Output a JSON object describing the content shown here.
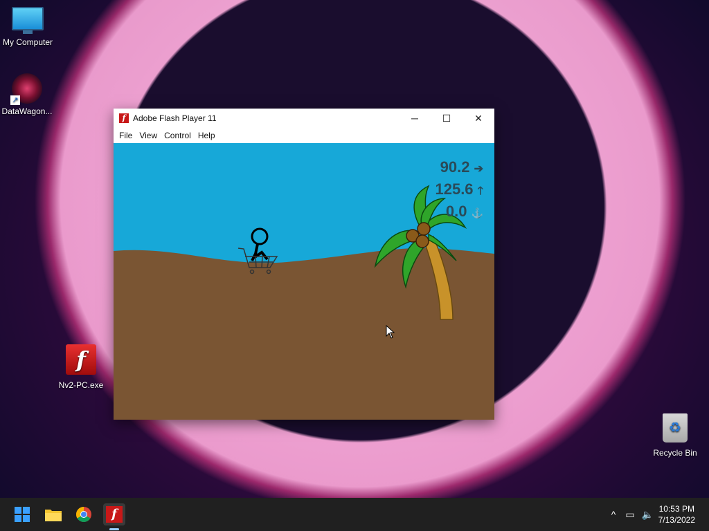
{
  "desktop": {
    "icons": [
      {
        "label": "My Computer",
        "icon": "computer-icon"
      },
      {
        "label": "DataWagon...",
        "icon": "datawagon-icon"
      },
      {
        "label": "Nv2-PC.exe",
        "icon": "flash-exe-icon"
      },
      {
        "label": "Recycle Bin",
        "icon": "recycle-bin-icon"
      }
    ]
  },
  "window": {
    "title": "Adobe Flash Player 11",
    "menu": [
      "File",
      "View",
      "Control",
      "Help"
    ],
    "controls": {
      "minimize": "─",
      "maximize": "☐",
      "close": "✕"
    }
  },
  "game": {
    "hud": [
      {
        "value": "90.2",
        "arrow": "➔"
      },
      {
        "value": "125.6",
        "arrow": "🡑"
      },
      {
        "value": "0.0",
        "arrow": "⚓"
      }
    ],
    "colors": {
      "sky": "#17a8d8",
      "ground": "#7a5533",
      "palm_leaf": "#2fa52a",
      "trunk": "#c8922a"
    }
  },
  "taskbar": {
    "apps": [
      "start-icon",
      "file-explorer-icon",
      "chrome-icon",
      "flash-player-icon"
    ],
    "clock_time": "10:53 PM",
    "clock_date": "7/13/2022"
  }
}
